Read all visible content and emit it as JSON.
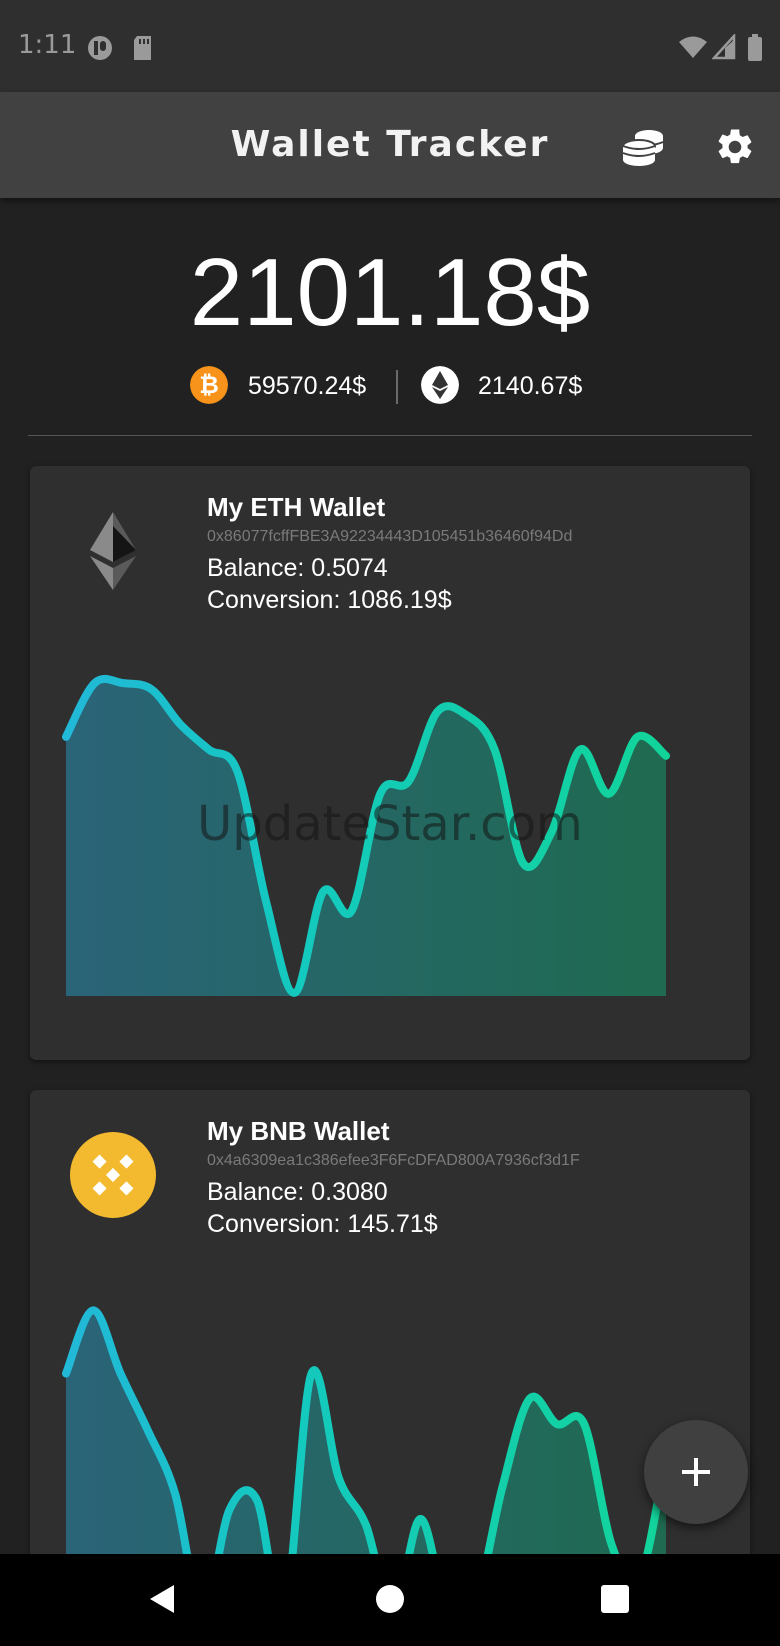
{
  "status_bar": {
    "time": "1:11",
    "icons": [
      "circle-status-icon",
      "sd-card-icon",
      "wifi-icon",
      "signal-icon",
      "battery-icon"
    ]
  },
  "app_bar": {
    "title": "Wallet Tracker",
    "actions": [
      "coins-icon",
      "gear-icon"
    ]
  },
  "summary": {
    "total": "2101.18$",
    "btc_price": "59570.24$",
    "eth_price": "2140.67$"
  },
  "colors": {
    "background": "#212121",
    "card": "#2f2f2f",
    "app_bar": "#414141",
    "btc": "#f7931a",
    "bnb": "#f3ba2f",
    "chart_start": "#22b8d8",
    "chart_end": "#12d49a"
  },
  "wallets": [
    {
      "name": "My ETH Wallet",
      "address": "0x86077fcffFBE3A92234443D105451b36460f94Dd",
      "balance": "Balance: 0.5074",
      "conversion": "Conversion: 1086.19$",
      "icon": "ethereum-icon",
      "chart": [
        0.82,
        0.99,
        0.99,
        0.97,
        0.86,
        0.78,
        0.71,
        0.3,
        0.01,
        0.33,
        0.27,
        0.64,
        0.68,
        0.9,
        0.89,
        0.78,
        0.42,
        0.52,
        0.78,
        0.64,
        0.82,
        0.76
      ]
    },
    {
      "name": "My BNB Wallet",
      "address": "0x4a6309ea1c386efee3F6FcDFAD800A7936cf3d1F",
      "balance": "Balance: 0.3080",
      "conversion": "Conversion: 145.71$",
      "icon": "binance-icon",
      "chart": [
        0.78,
        0.98,
        0.78,
        0.6,
        0.4,
        0.02,
        0.35,
        0.38,
        0.02,
        0.78,
        0.45,
        0.3,
        0.02,
        0.32,
        0.02,
        0.05,
        0.42,
        0.7,
        0.62,
        0.62,
        0.24,
        0.12,
        0.52
      ]
    }
  ],
  "watermark": "UpdateStar.com",
  "fab": {
    "icon": "plus-icon"
  },
  "nav_bar": [
    "back-icon",
    "home-icon",
    "recents-icon"
  ]
}
